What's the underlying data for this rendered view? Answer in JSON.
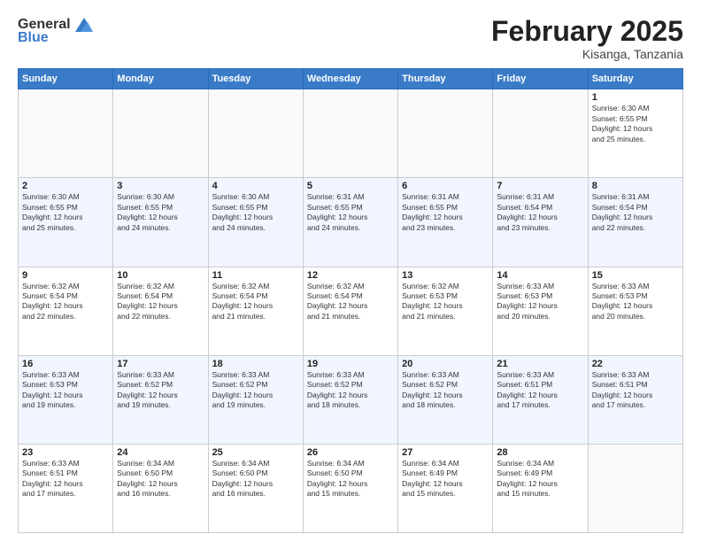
{
  "header": {
    "logo_general": "General",
    "logo_blue": "Blue",
    "month_title": "February 2025",
    "location": "Kisanga, Tanzania"
  },
  "days_of_week": [
    "Sunday",
    "Monday",
    "Tuesday",
    "Wednesday",
    "Thursday",
    "Friday",
    "Saturday"
  ],
  "weeks": [
    [
      {
        "day": "",
        "info": ""
      },
      {
        "day": "",
        "info": ""
      },
      {
        "day": "",
        "info": ""
      },
      {
        "day": "",
        "info": ""
      },
      {
        "day": "",
        "info": ""
      },
      {
        "day": "",
        "info": ""
      },
      {
        "day": "1",
        "info": "Sunrise: 6:30 AM\nSunset: 6:55 PM\nDaylight: 12 hours\nand 25 minutes."
      }
    ],
    [
      {
        "day": "2",
        "info": "Sunrise: 6:30 AM\nSunset: 6:55 PM\nDaylight: 12 hours\nand 25 minutes."
      },
      {
        "day": "3",
        "info": "Sunrise: 6:30 AM\nSunset: 6:55 PM\nDaylight: 12 hours\nand 24 minutes."
      },
      {
        "day": "4",
        "info": "Sunrise: 6:30 AM\nSunset: 6:55 PM\nDaylight: 12 hours\nand 24 minutes."
      },
      {
        "day": "5",
        "info": "Sunrise: 6:31 AM\nSunset: 6:55 PM\nDaylight: 12 hours\nand 24 minutes."
      },
      {
        "day": "6",
        "info": "Sunrise: 6:31 AM\nSunset: 6:55 PM\nDaylight: 12 hours\nand 23 minutes."
      },
      {
        "day": "7",
        "info": "Sunrise: 6:31 AM\nSunset: 6:54 PM\nDaylight: 12 hours\nand 23 minutes."
      },
      {
        "day": "8",
        "info": "Sunrise: 6:31 AM\nSunset: 6:54 PM\nDaylight: 12 hours\nand 22 minutes."
      }
    ],
    [
      {
        "day": "9",
        "info": "Sunrise: 6:32 AM\nSunset: 6:54 PM\nDaylight: 12 hours\nand 22 minutes."
      },
      {
        "day": "10",
        "info": "Sunrise: 6:32 AM\nSunset: 6:54 PM\nDaylight: 12 hours\nand 22 minutes."
      },
      {
        "day": "11",
        "info": "Sunrise: 6:32 AM\nSunset: 6:54 PM\nDaylight: 12 hours\nand 21 minutes."
      },
      {
        "day": "12",
        "info": "Sunrise: 6:32 AM\nSunset: 6:54 PM\nDaylight: 12 hours\nand 21 minutes."
      },
      {
        "day": "13",
        "info": "Sunrise: 6:32 AM\nSunset: 6:53 PM\nDaylight: 12 hours\nand 21 minutes."
      },
      {
        "day": "14",
        "info": "Sunrise: 6:33 AM\nSunset: 6:53 PM\nDaylight: 12 hours\nand 20 minutes."
      },
      {
        "day": "15",
        "info": "Sunrise: 6:33 AM\nSunset: 6:53 PM\nDaylight: 12 hours\nand 20 minutes."
      }
    ],
    [
      {
        "day": "16",
        "info": "Sunrise: 6:33 AM\nSunset: 6:53 PM\nDaylight: 12 hours\nand 19 minutes."
      },
      {
        "day": "17",
        "info": "Sunrise: 6:33 AM\nSunset: 6:52 PM\nDaylight: 12 hours\nand 19 minutes."
      },
      {
        "day": "18",
        "info": "Sunrise: 6:33 AM\nSunset: 6:52 PM\nDaylight: 12 hours\nand 19 minutes."
      },
      {
        "day": "19",
        "info": "Sunrise: 6:33 AM\nSunset: 6:52 PM\nDaylight: 12 hours\nand 18 minutes."
      },
      {
        "day": "20",
        "info": "Sunrise: 6:33 AM\nSunset: 6:52 PM\nDaylight: 12 hours\nand 18 minutes."
      },
      {
        "day": "21",
        "info": "Sunrise: 6:33 AM\nSunset: 6:51 PM\nDaylight: 12 hours\nand 17 minutes."
      },
      {
        "day": "22",
        "info": "Sunrise: 6:33 AM\nSunset: 6:51 PM\nDaylight: 12 hours\nand 17 minutes."
      }
    ],
    [
      {
        "day": "23",
        "info": "Sunrise: 6:33 AM\nSunset: 6:51 PM\nDaylight: 12 hours\nand 17 minutes."
      },
      {
        "day": "24",
        "info": "Sunrise: 6:34 AM\nSunset: 6:50 PM\nDaylight: 12 hours\nand 16 minutes."
      },
      {
        "day": "25",
        "info": "Sunrise: 6:34 AM\nSunset: 6:50 PM\nDaylight: 12 hours\nand 16 minutes."
      },
      {
        "day": "26",
        "info": "Sunrise: 6:34 AM\nSunset: 6:50 PM\nDaylight: 12 hours\nand 15 minutes."
      },
      {
        "day": "27",
        "info": "Sunrise: 6:34 AM\nSunset: 6:49 PM\nDaylight: 12 hours\nand 15 minutes."
      },
      {
        "day": "28",
        "info": "Sunrise: 6:34 AM\nSunset: 6:49 PM\nDaylight: 12 hours\nand 15 minutes."
      },
      {
        "day": "",
        "info": ""
      }
    ]
  ]
}
